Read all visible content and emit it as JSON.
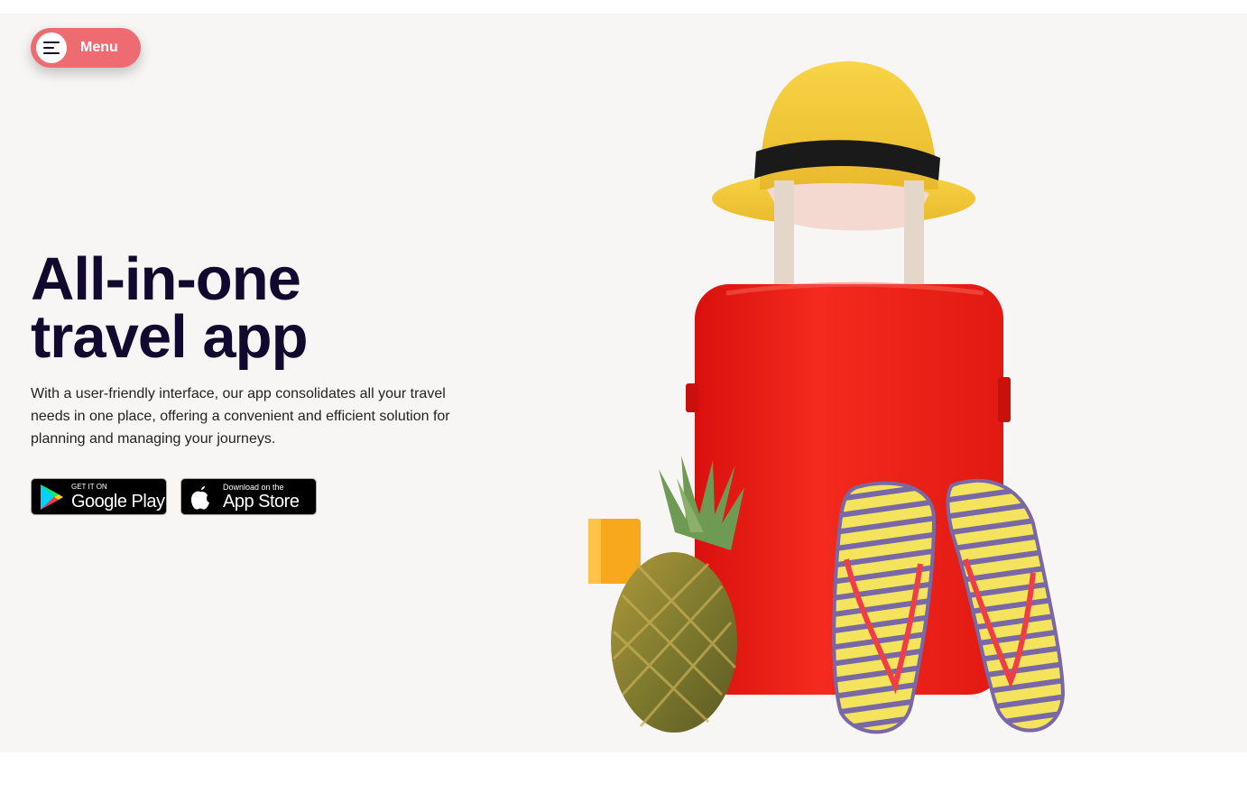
{
  "header": {
    "menu_label": "Menu"
  },
  "hero": {
    "title_line1": "All-in-one",
    "title_line2": "travel app",
    "description": "With a user-friendly interface, our app consolidates all your travel needs in one place, offering a convenient and efficient solution for planning and managing your journeys."
  },
  "stores": {
    "google": {
      "small": "GET IT ON",
      "big": "Google Play"
    },
    "apple": {
      "small": "Download on the",
      "big": "App Store"
    }
  },
  "colors": {
    "menu_button": "#ee6b72",
    "headline": "#12092f",
    "hero_background": "#f7f6f5",
    "suitcase": "#f0231c",
    "hat": "#f5c93a"
  },
  "icons": {
    "menu": "hamburger-icon",
    "google_play": "google-play-icon",
    "apple": "apple-icon"
  }
}
